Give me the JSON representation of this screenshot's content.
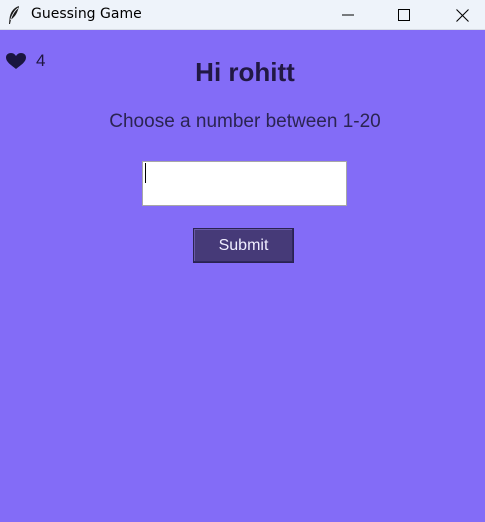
{
  "window": {
    "title": "Guessing Game",
    "icon": "feather-icon",
    "controls": [
      "minimize-icon",
      "maximize-icon",
      "close-icon"
    ]
  },
  "game": {
    "lives": "4",
    "lives_icon": "heart-icon",
    "greeting": "Hi rohitt",
    "prompt": "Choose a number between 1-20",
    "guess_value": "",
    "submit_label": "Submit"
  },
  "colors": {
    "background": "#836cf7",
    "button": "#463a78",
    "heading": "#211844"
  }
}
